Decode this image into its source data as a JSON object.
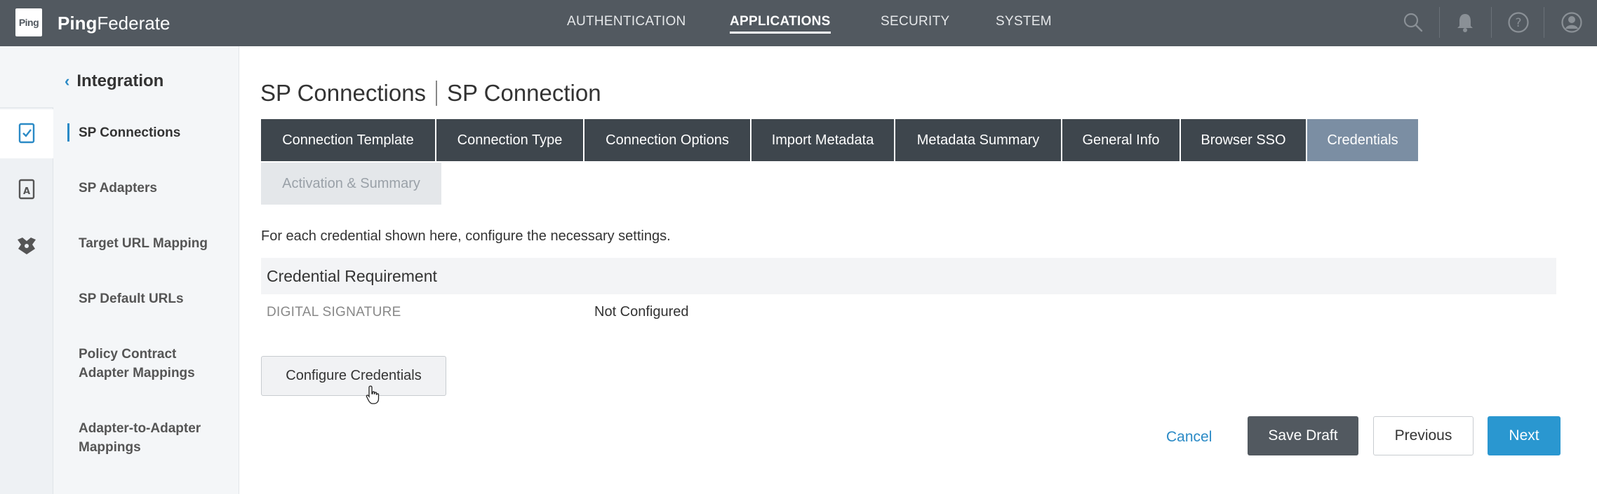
{
  "app": {
    "logo_text": "Ping",
    "brand_bold": "Ping",
    "brand_light": "Federate"
  },
  "topnav": {
    "items": [
      "AUTHENTICATION",
      "APPLICATIONS",
      "SECURITY",
      "SYSTEM"
    ],
    "active": "APPLICATIONS"
  },
  "top_icons": [
    "search-icon",
    "bell-icon",
    "help-icon",
    "user-icon"
  ],
  "rail_icons": [
    "connection-icon",
    "adapter-icon",
    "federation-icon"
  ],
  "sidebar": {
    "back_label": "Integration",
    "items": [
      {
        "label": "SP Connections",
        "active": true
      },
      {
        "label": "SP Adapters",
        "active": false
      },
      {
        "label": "Target URL Mapping",
        "active": false
      },
      {
        "label": "SP Default URLs",
        "active": false
      },
      {
        "label": "Policy Contract Adapter Mappings",
        "active": false
      },
      {
        "label": "Adapter-to-Adapter Mappings",
        "active": false
      }
    ]
  },
  "main": {
    "title_parent": "SP Connections",
    "title_current": "SP Connection",
    "tabs": [
      {
        "label": "Connection Template",
        "state": "done"
      },
      {
        "label": "Connection Type",
        "state": "done"
      },
      {
        "label": "Connection Options",
        "state": "done"
      },
      {
        "label": "Import Metadata",
        "state": "done"
      },
      {
        "label": "Metadata Summary",
        "state": "done"
      },
      {
        "label": "General Info",
        "state": "done"
      },
      {
        "label": "Browser SSO",
        "state": "done"
      },
      {
        "label": "Credentials",
        "state": "current"
      },
      {
        "label": "Activation & Summary",
        "state": "disabled"
      }
    ],
    "description": "For each credential shown here, configure the necessary settings.",
    "requirement_header": "Credential Requirement",
    "requirement_label": "DIGITAL SIGNATURE",
    "requirement_value": "Not Configured",
    "configure_button": "Configure Credentials"
  },
  "footer": {
    "cancel": "Cancel",
    "save_draft": "Save Draft",
    "previous": "Previous",
    "next": "Next"
  },
  "colors": {
    "topbar": "#525960",
    "tab_done": "#3e464d",
    "tab_current": "#7b8ea3",
    "accent": "#2a97d0"
  }
}
